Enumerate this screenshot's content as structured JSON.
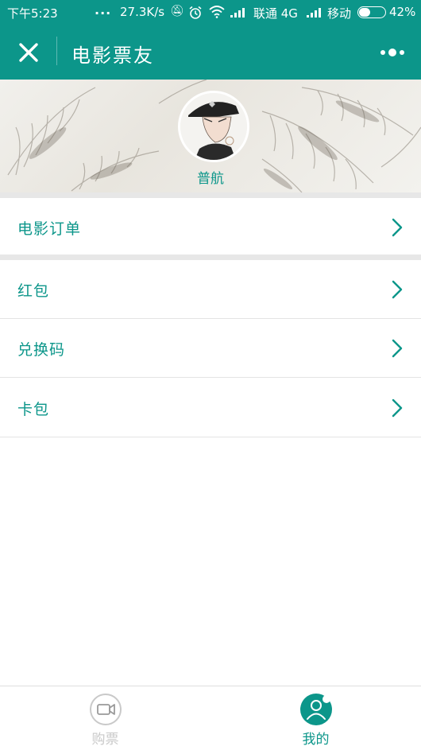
{
  "status_bar": {
    "time": "下午5:23",
    "dots": "...",
    "net_speed": "27.3K/s",
    "carrier1": "联通 4G",
    "carrier2": "移动",
    "battery": "42%",
    "battery_level": 0.42
  },
  "nav": {
    "title": "电影票友"
  },
  "profile": {
    "username": "普航"
  },
  "menu": {
    "items": [
      {
        "label": "电影订单"
      },
      {
        "label": "红包"
      },
      {
        "label": "兑换码"
      },
      {
        "label": "卡包"
      }
    ]
  },
  "tabs": [
    {
      "label": "购票",
      "active": false
    },
    {
      "label": "我的",
      "active": true
    }
  ],
  "colors": {
    "brand": "#0c968a",
    "inactive": "#c9c9c9"
  }
}
